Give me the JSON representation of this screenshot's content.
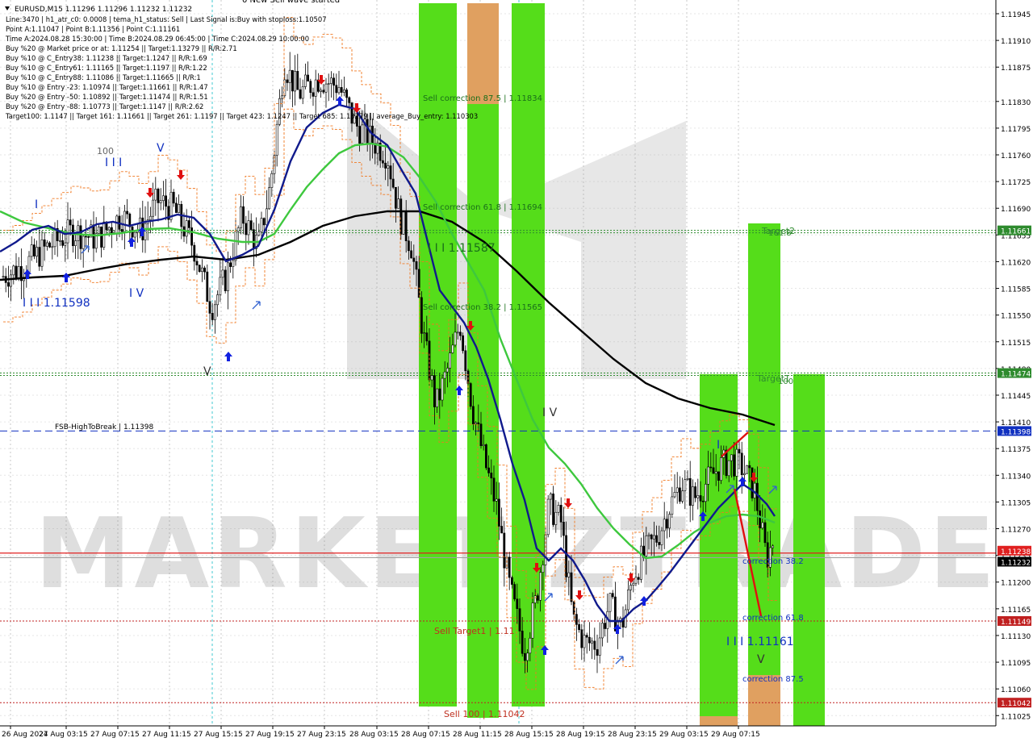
{
  "header": {
    "symbol_line": "EURUSD,M15  1.11296 1.11296 1.11232 1.11232",
    "info_lines": [
      "Line:3470 | h1_atr_c0: 0.0008 | tema_h1_status: Sell | Last Signal is:Buy with stoploss:1.10507",
      "Point A:1.11047 | Point B:1.11356 | Point C:1.11161",
      "Time A:2024.08.28 15:30:00 | Time B:2024.08.29 06:45:00 | Time C:2024.08.29 10:00:00",
      "Buy %20 @ Market price or at: 1.11254 || Target:1.13279 || R/R:2.71",
      "Buy %10 @ C_Entry38: 1.11238 || Target:1.1247 || R/R:1.69",
      "Buy %10 @ C_Entry61: 1.11165 || Target:1.1197 || R/R:1.22",
      "Buy %10 @ C_Entry88: 1.11086 || Target:1.11665 || R/R:1",
      "Buy %10 @ Entry -23: 1.10974 || Target:1.11661 || R/R:1.47",
      "Buy %20 @ Entry -50: 1.10892 || Target:1.11474 || R/R:1.51",
      "Buy %20 @ Entry -88: 1.10773 || Target:1.1147 || R/R:2.62",
      "Target100: 1.1147 || Target 161: 1.11661 || Target 261: 1.1197 || Target 423: 1.1247 || Target 685: 1.13279 || average_Buy_entry: 1.110303"
    ],
    "top_cut_text": "0 New Sell wave started"
  },
  "chart_data": {
    "type": "candlestick",
    "symbol": "EURUSD",
    "timeframe": "M15",
    "ohlc": {
      "open": 1.11296,
      "high": 1.11296,
      "low": 1.11232,
      "close": 1.11232
    },
    "ylim": [
      1.1102,
      1.11945
    ],
    "y_ticks": [
      "1.11945",
      "1.11910",
      "1.11875",
      "1.11830",
      "1.11795",
      "1.11760",
      "1.11725",
      "1.11690",
      "1.11655",
      "1.11620",
      "1.11585",
      "1.11550",
      "1.11515",
      "1.11480",
      "1.11445",
      "1.11410",
      "1.11375",
      "1.11340",
      "1.11305",
      "1.11270",
      "1.11235",
      "1.11200",
      "1.11165",
      "1.11130",
      "1.11095",
      "1.11060",
      "1.11025"
    ],
    "x_ticks": [
      "26 Aug 2024",
      "27 Aug 03:15",
      "27 Aug 07:15",
      "27 Aug 11:15",
      "27 Aug 15:15",
      "27 Aug 19:15",
      "27 Aug 23:15",
      "28 Aug 03:15",
      "28 Aug 07:15",
      "28 Aug 11:15",
      "28 Aug 15:15",
      "28 Aug 19:15",
      "28 Aug 23:15",
      "29 Aug 03:15",
      "29 Aug 07:15"
    ],
    "price_labels": [
      {
        "value": 1.11661,
        "text": "1.11661",
        "color": "#2e8b2e"
      },
      {
        "value": 1.11474,
        "text": "1.11474",
        "color": "#2e8b2e"
      },
      {
        "value": 1.11398,
        "text": "1.11398",
        "color": "#1030c0"
      },
      {
        "value": 1.11238,
        "text": "1.11238",
        "color": "#e02020"
      },
      {
        "value": 1.11232,
        "text": "1.11232",
        "color": "#000000"
      },
      {
        "value": 1.11149,
        "text": "1.11149",
        "color": "#c02020"
      },
      {
        "value": 1.11042,
        "text": "1.11042",
        "color": "#c02020"
      }
    ],
    "levels": [
      {
        "value": 1.11661,
        "label": "Target2",
        "style": "dotted",
        "color": "#2e8b2e"
      },
      {
        "value": 1.11474,
        "label": "Target1",
        "style": "dotted",
        "color": "#2e8b2e"
      },
      {
        "value": 1.11398,
        "label": "FSB-HighToBreak | 1.11398",
        "style": "dashed",
        "color": "#1030c0"
      },
      {
        "value": 1.11238,
        "label": "",
        "style": "solid",
        "color": "#e02020"
      },
      {
        "value": 1.11232,
        "label": "",
        "style": "solid",
        "color": "#a0a0a0"
      },
      {
        "value": 1.11149,
        "label": "",
        "style": "dotted",
        "color": "#c02020"
      },
      {
        "value": 1.11042,
        "label": "",
        "style": "dotted",
        "color": "#c02020"
      }
    ],
    "annotations": [
      "Sell correction 87.5 | 1.11834",
      "Sell correction 61.8 | 1.11694",
      "Sell correction 38.2 | 1.11565",
      "Sell Target1 | 1.11",
      "Sell 100 | 1.11042",
      "correction 38.2",
      "correction 61.8",
      "correction 87.5",
      "I I I 1.11161",
      "I I I 1.11587",
      "I I I 1.11598",
      "Target2",
      "161.8",
      "Target1",
      "100",
      "100",
      "I I I",
      "I V",
      "V",
      "I",
      "I V",
      "V",
      "I",
      "V",
      "I V"
    ],
    "watermark": "MARKETIZTRADE",
    "series_colors": {
      "ma_black": "#000000",
      "ma_green": "#3ec83e",
      "ma_navy": "#101a8c",
      "zone_green": "#55dd1a",
      "zone_orange": "#e0a060"
    }
  }
}
